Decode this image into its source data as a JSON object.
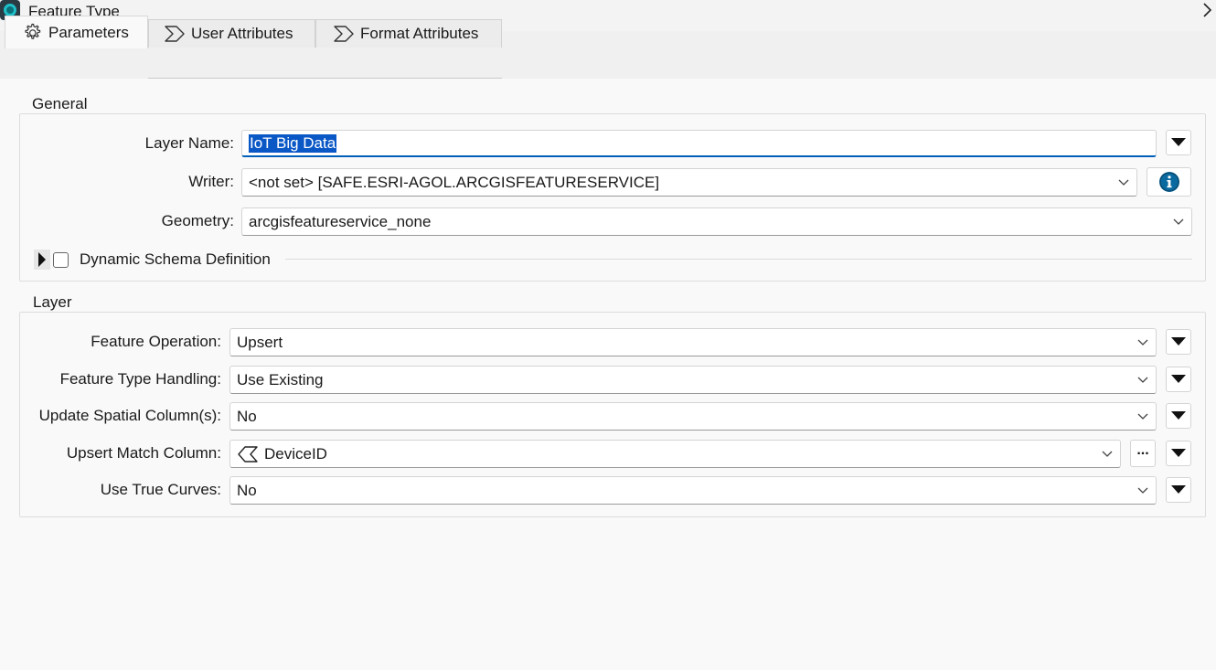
{
  "window": {
    "title": "Feature Type"
  },
  "tabs": [
    {
      "label": "Parameters",
      "icon": "gear-icon",
      "active": true
    },
    {
      "label": "User Attributes",
      "icon": "sigma-icon",
      "active": false
    },
    {
      "label": "Format Attributes",
      "icon": "sigma-icon",
      "active": false
    }
  ],
  "general": {
    "title": "General",
    "layer_name": {
      "label": "Layer Name:",
      "value": "IoT Big Data"
    },
    "writer": {
      "label": "Writer:",
      "value": "<not set> [SAFE.ESRI-AGOL.ARCGISFEATURESERVICE]"
    },
    "geometry": {
      "label": "Geometry:",
      "value": "arcgisfeatureservice_none"
    },
    "dynamic_schema": {
      "label": "Dynamic Schema Definition",
      "checked": false
    }
  },
  "layer": {
    "title": "Layer",
    "feature_operation": {
      "label": "Feature Operation:",
      "value": "Upsert"
    },
    "feature_type_handling": {
      "label": "Feature Type Handling:",
      "value": "Use Existing"
    },
    "update_spatial": {
      "label": "Update Spatial Column(s):",
      "value": "No"
    },
    "upsert_match": {
      "label": "Upsert Match Column:",
      "value": "DeviceID",
      "ellipsis": "..."
    },
    "true_curves": {
      "label": "Use True Curves:",
      "value": "No"
    }
  },
  "colors": {
    "accent": "#005fb8",
    "selection": "#0a57c6",
    "info": "#0a6aa0"
  }
}
